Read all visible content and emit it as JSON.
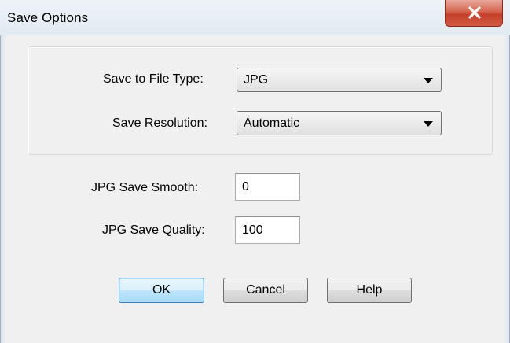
{
  "window": {
    "title": "Save Options",
    "close_icon": "close-icon"
  },
  "file_type": {
    "label": "Save to File Type:",
    "selected": "JPG"
  },
  "resolution": {
    "label": "Save Resolution:",
    "selected": "Automatic"
  },
  "jpg_smooth": {
    "label": "JPG Save Smooth:",
    "value": "0"
  },
  "jpg_quality": {
    "label": "JPG Save Quality:",
    "value": "100"
  },
  "buttons": {
    "ok": "OK",
    "cancel": "Cancel",
    "help": "Help"
  },
  "colors": {
    "close_button": "#c4402a",
    "default_button_border": "#3c7fb1",
    "dialog_background": "#f0f0f0"
  }
}
